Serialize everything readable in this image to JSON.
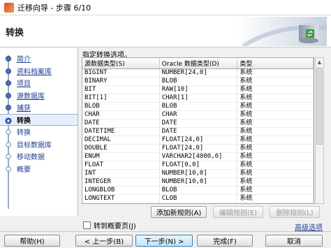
{
  "window": {
    "title": "迁移向导 - 步骤 6/10"
  },
  "header": {
    "step_title": "转换"
  },
  "nav": {
    "items": [
      {
        "label": "简介",
        "state": "done"
      },
      {
        "label": "资料档案库",
        "state": "done"
      },
      {
        "label": "项目",
        "state": "done"
      },
      {
        "label": "源数据库",
        "state": "done"
      },
      {
        "label": "捕获",
        "state": "done"
      },
      {
        "label": "转换",
        "state": "current"
      },
      {
        "label": "转换",
        "state": "future"
      },
      {
        "label": "目标数据库",
        "state": "future"
      },
      {
        "label": "移动数据",
        "state": "future"
      },
      {
        "label": "概要",
        "state": "future"
      }
    ]
  },
  "main": {
    "instruction": "指定转换选项。",
    "columns": [
      "源数据类型(S)",
      "Oracle 数据类型(D)",
      "类型"
    ],
    "rows": [
      [
        "BIGINT",
        "NUMBER[24,0]",
        "系统"
      ],
      [
        "BINARY",
        "BLOB",
        "系统"
      ],
      [
        "BIT",
        "RAW[10]",
        "系统"
      ],
      [
        "BIT[1]",
        "CHAR[1]",
        "系统"
      ],
      [
        "BLOB",
        "BLOB",
        "系统"
      ],
      [
        "CHAR",
        "CHAR",
        "系统"
      ],
      [
        "DATE",
        "DATE",
        "系统"
      ],
      [
        "DATETIME",
        "DATE",
        "系统"
      ],
      [
        "DECIMAL",
        "FLOAT[24,0]",
        "系统"
      ],
      [
        "DOUBLE",
        "FLOAT[24,0]",
        "系统"
      ],
      [
        "ENUM",
        "VARCHAR2[4000,0]",
        "系统"
      ],
      [
        "FLOAT",
        "FLOAT[0,0]",
        "系统"
      ],
      [
        "INT",
        "NUMBER[10,0]",
        "系统"
      ],
      [
        "INTEGER",
        "NUMBER[10,0]",
        "系统"
      ],
      [
        "LONGBLOB",
        "BLOB",
        "系统"
      ],
      [
        "LONGTEXT",
        "CLOB",
        "系统"
      ]
    ],
    "add_rule": "添加新规则(A)",
    "edit_rule": "编辑规则(E)",
    "delete_rule": "删除规则(L)",
    "summary_checkbox": "转到概要页(J)",
    "advanced_link": "高级选项"
  },
  "footer": {
    "help": "帮助(H)",
    "back": "< 上一步(B)",
    "next": "下一步(N) >",
    "finish": "完成(F)",
    "cancel": "取消"
  },
  "colors": {
    "link": "#1f3f8f",
    "current_bg": "#e6eefb",
    "primary_btn": "#bee6fd"
  }
}
